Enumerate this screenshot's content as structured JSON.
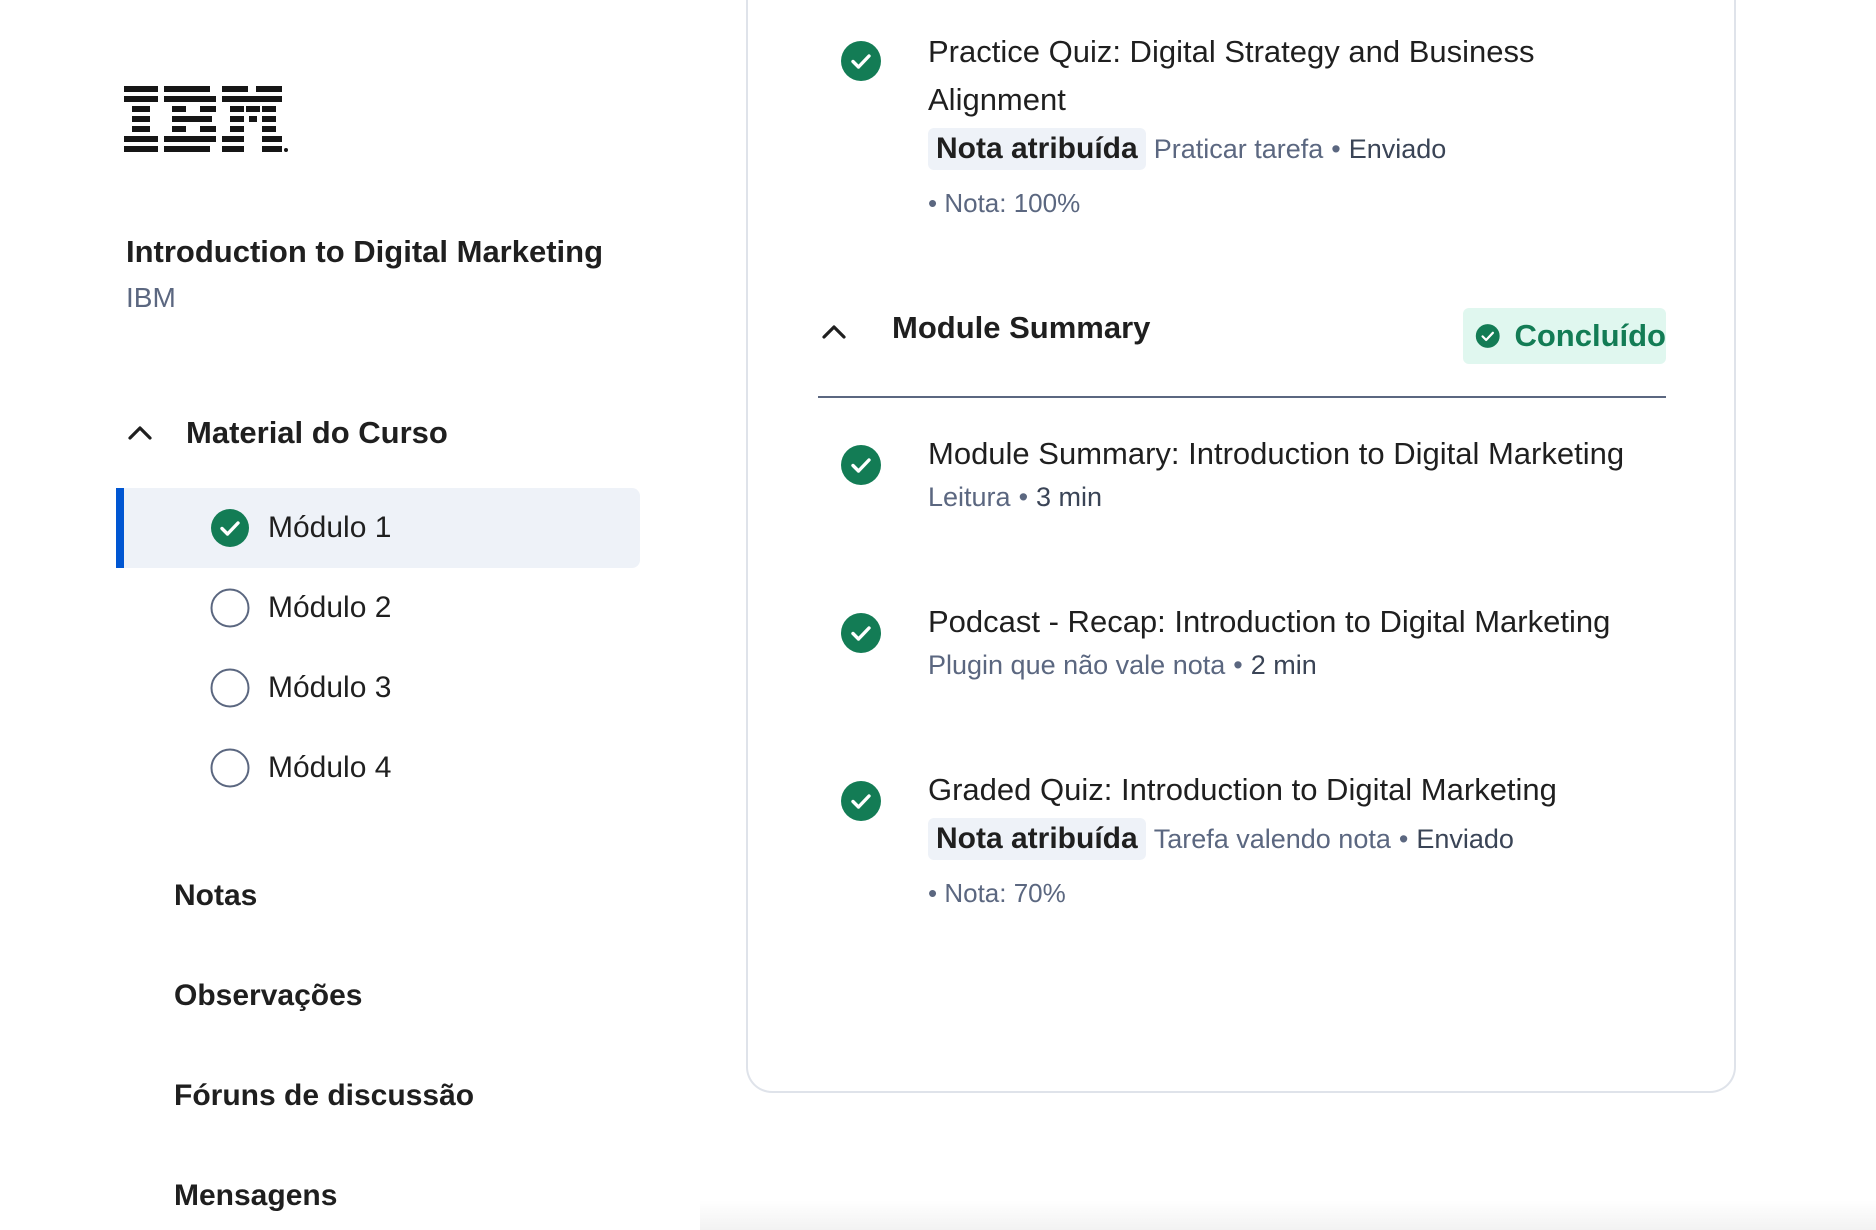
{
  "brand": {
    "logo_text": "IBM"
  },
  "course": {
    "title": "Introduction to Digital Marketing",
    "org": "IBM"
  },
  "sidebar": {
    "material_label": "Material do Curso",
    "modules": [
      {
        "label": "Módulo 1",
        "completed": true,
        "active": true
      },
      {
        "label": "Módulo 2",
        "completed": false,
        "active": false
      },
      {
        "label": "Módulo 3",
        "completed": false,
        "active": false
      },
      {
        "label": "Módulo 4",
        "completed": false,
        "active": false
      }
    ],
    "links": [
      "Notas",
      "Observações",
      "Fóruns de discussão",
      "Mensagens"
    ]
  },
  "content": {
    "top_item": {
      "title": "Practice Quiz: Digital Strategy and Business Alignment",
      "badge": "Nota atribuída",
      "type": "Praticar tarefa",
      "status": "Enviado",
      "score": "Nota: 100%"
    },
    "section": {
      "title": "Module Summary",
      "status_label": "Concluído",
      "items": [
        {
          "title": "Module Summary: Introduction to Digital Marketing",
          "type": "Leitura",
          "duration": "3 min"
        },
        {
          "title": "Podcast - Recap: Introduction to Digital Marketing",
          "type": "Plugin que não vale nota",
          "duration": "2 min"
        },
        {
          "title": "Graded Quiz: Introduction to Digital Marketing",
          "badge": "Nota atribuída",
          "type": "Tarefa valendo nota",
          "status": "Enviado",
          "score": "Nota: 70%"
        }
      ]
    }
  },
  "colors": {
    "accent": "#0056d2",
    "success": "#137c55",
    "success_bg": "#e0f7ef",
    "muted": "#5b6780"
  }
}
